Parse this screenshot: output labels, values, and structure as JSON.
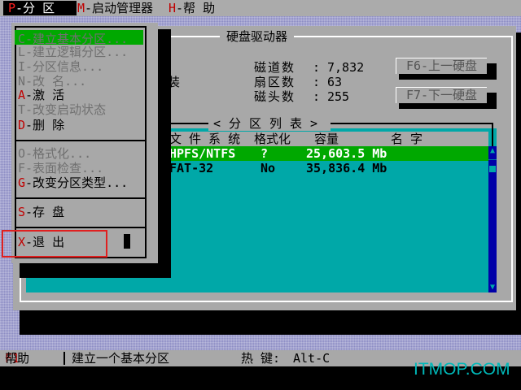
{
  "menubar": {
    "items": [
      {
        "hotkey": "P",
        "label": "-分  区"
      },
      {
        "hotkey": "M",
        "label": "-启动管理器"
      },
      {
        "hotkey": "H",
        "label": "-帮  助"
      }
    ]
  },
  "window": {
    "title": "硬盘驱动器",
    "partial_text": "装",
    "disk_info": [
      {
        "label": "磁道数",
        "colon": ":",
        "value": "7,832"
      },
      {
        "label": "扇区数",
        "colon": ":",
        "value": "63"
      },
      {
        "label": "磁头数",
        "colon": ":",
        "value": "255"
      }
    ],
    "prev_disk_button": "F6-上一硬盘",
    "next_disk_button": "F7-下一硬盘"
  },
  "partition_list": {
    "title": "<分区列表>",
    "columns": {
      "filesystem": "文 件 系 统",
      "format": "格式化",
      "capacity": "容量",
      "name": "名  字"
    },
    "rows": [
      {
        "marker": "y",
        "filesystem": "HPFS/NTFS",
        "format": "?",
        "capacity": "25,603.5 Mb",
        "name": ""
      },
      {
        "marker": "y",
        "filesystem": "FAT-32",
        "format": "No",
        "capacity": "35,836.4 Mb",
        "name": ""
      }
    ]
  },
  "dropdown": {
    "items": [
      {
        "hotkey": "C",
        "label": "-建立基本分区...",
        "enabled": false,
        "selected": true
      },
      {
        "hotkey": "L",
        "label": "-建立逻辑分区...",
        "enabled": false
      },
      {
        "hotkey": "I",
        "label": "-分区信息...",
        "enabled": false
      },
      {
        "hotkey": "N",
        "label": "-改  名...",
        "enabled": false
      },
      {
        "hotkey": "A",
        "label": "-激  活",
        "enabled": true
      },
      {
        "hotkey": "T",
        "label": "-改变启动状态",
        "enabled": false
      },
      {
        "hotkey": "D",
        "label": "-删  除",
        "enabled": true
      },
      {
        "hotkey": "O",
        "label": "-格式化...",
        "enabled": false
      },
      {
        "hotkey": "F",
        "label": "-表面检查...",
        "enabled": false
      },
      {
        "hotkey": "G",
        "label": "-改变分区类型...",
        "enabled": true
      },
      {
        "hotkey": "S",
        "label": "-存  盘",
        "enabled": true
      },
      {
        "hotkey": "X",
        "label": "-退  出",
        "enabled": true
      }
    ]
  },
  "statusbar": {
    "help_key": "F1",
    "help_label": " 帮助",
    "message": "建立一个基本分区",
    "hotkey_label": "热  键:",
    "hotkey_value": "Alt-C"
  },
  "watermark": "ITMOP.COM",
  "colors": {
    "menubar_bg": "#ababab",
    "selection_green": "#00a800",
    "list_cyan": "#00a8a8",
    "scrollbar_blue": "#0000a8",
    "hotkey_red": "#c00000",
    "annotation_red": "#e02020",
    "desktop_lavender": "#8c8cc4"
  }
}
